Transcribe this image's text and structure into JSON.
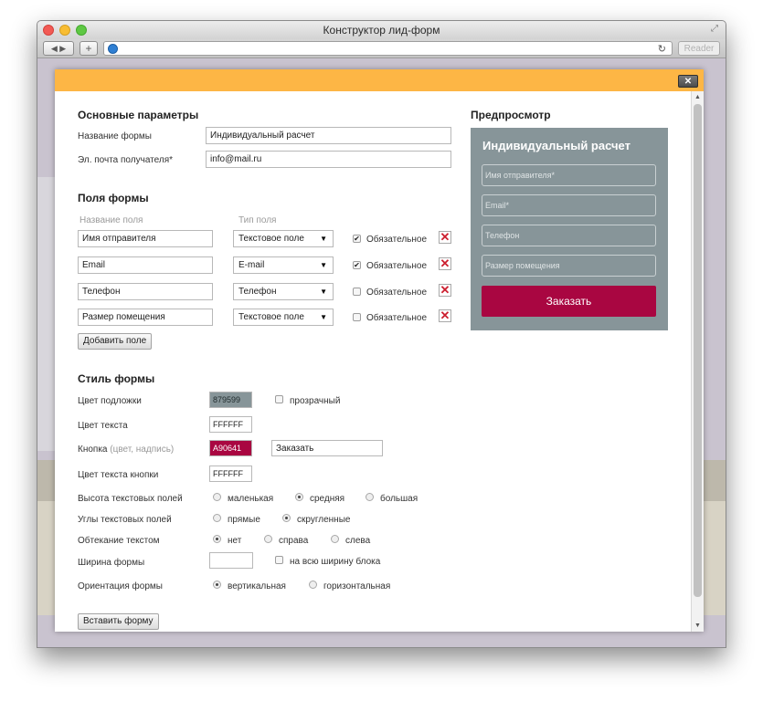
{
  "window": {
    "title": "Конструктор лид-форм"
  },
  "browser": {
    "reader_label": "Reader"
  },
  "modal": {
    "close_label": "✕",
    "main": {
      "title": "Основные параметры",
      "form_name_label": "Название формы",
      "form_name_value": "Индивидуальный расчет",
      "email_label": "Эл. почта получателя*",
      "email_value": "info@mail.ru"
    },
    "fields": {
      "title": "Поля формы",
      "col_name": "Название поля",
      "col_type": "Тип поля",
      "rows": [
        {
          "name": "Имя отправителя",
          "type": "Текстовое поле",
          "required_label": "Обязательное",
          "required": true
        },
        {
          "name": "Email",
          "type": "E-mail",
          "required_label": "Обязательное",
          "required": true
        },
        {
          "name": "Телефон",
          "type": "Телефон",
          "required_label": "Обязательное",
          "required": false
        },
        {
          "name": "Размер помещения",
          "type": "Текстовое поле",
          "required_label": "Обязательное",
          "required": false
        }
      ],
      "add_button": "Добавить поле"
    },
    "style": {
      "title": "Стиль формы",
      "bg_color_label": "Цвет подложки",
      "bg_color_value": "879599",
      "transparent_label": "прозрачный",
      "text_color_label": "Цвет текста",
      "text_color_value": "FFFFFF",
      "button_label": "Кнопка",
      "button_label_hint": "(цвет, надпись)",
      "button_color_value": "A90641",
      "button_text_value": "Заказать",
      "button_text_color_label": "Цвет текста кнопки",
      "button_text_color_value": "FFFFFF",
      "field_height_label": "Высота текстовых полей",
      "field_height_options": [
        "маленькая",
        "средняя",
        "большая"
      ],
      "field_height_selected": "средняя",
      "corners_label": "Углы текстовых полей",
      "corners_options": [
        "прямые",
        "скругленные"
      ],
      "corners_selected": "скругленные",
      "wrap_label": "Обтекание текстом",
      "wrap_options": [
        "нет",
        "справа",
        "слева"
      ],
      "wrap_selected": "нет",
      "width_label": "Ширина формы",
      "width_value": "",
      "full_width_label": "на всю ширину блока",
      "orientation_label": "Ориентация формы",
      "orientation_options": [
        "вертикальная",
        "горизонтальная"
      ],
      "orientation_selected": "вертикальная"
    },
    "insert_button": "Вставить форму",
    "preview": {
      "title": "Предпросмотр",
      "form_title": "Индивидуальный расчет",
      "fields": [
        "Имя отправителя*",
        "Email*",
        "Телефон",
        "Размер помещения"
      ],
      "button": "Заказать"
    }
  },
  "colors": {
    "accent_header": "#fdb645",
    "preview_bg": "#879599",
    "button_bg": "#a90641",
    "delete_icon": "#cc1f2f"
  }
}
